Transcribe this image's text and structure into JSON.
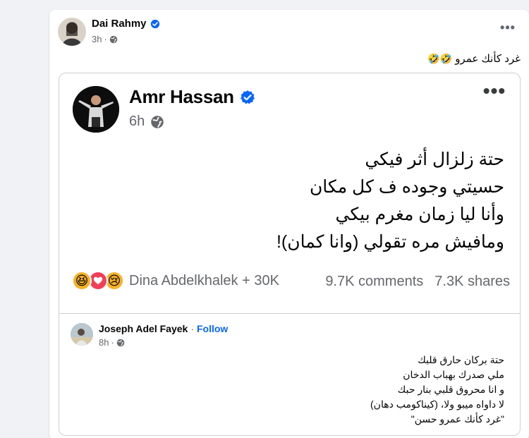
{
  "post": {
    "author": "Dai Rahmy",
    "time": "3h",
    "dot": "·",
    "caption": "غرد كأنك عمرو",
    "caption_emojis": "🤣🤣"
  },
  "shared": {
    "author": "Amr Hassan",
    "time": "6h",
    "poem": [
      "حتة زلزال أثر فيكي",
      "حسيتي وجوده ف كل مكان",
      "وأنا ليا زمان مغرم بيكي",
      "ومافيش مره تقولي (وانا كمان)!"
    ],
    "reactions": {
      "emojis": [
        "😆",
        "❤",
        "😢"
      ],
      "text": "Dina Abdelkhalek + 30K"
    },
    "comments": "9.7K comments",
    "shares": "7.3K shares"
  },
  "comment": {
    "author": "Joseph Adel Fayek",
    "separator": "·",
    "follow": "Follow",
    "time": "8h",
    "dot": "·",
    "lines": [
      "حتة بركان حارق قلبك",
      "ملي صدرك بهباب الدخان",
      "و انا محروق قلبي بنار حبك",
      "لا داواه ميبو ولا، (كيناكومب دهان)",
      "\"غرد كأنك عمرو حسن\""
    ]
  },
  "colors": {
    "verified": "#0866ff",
    "link": "#0866ff",
    "secondary_text": "#65676b"
  }
}
